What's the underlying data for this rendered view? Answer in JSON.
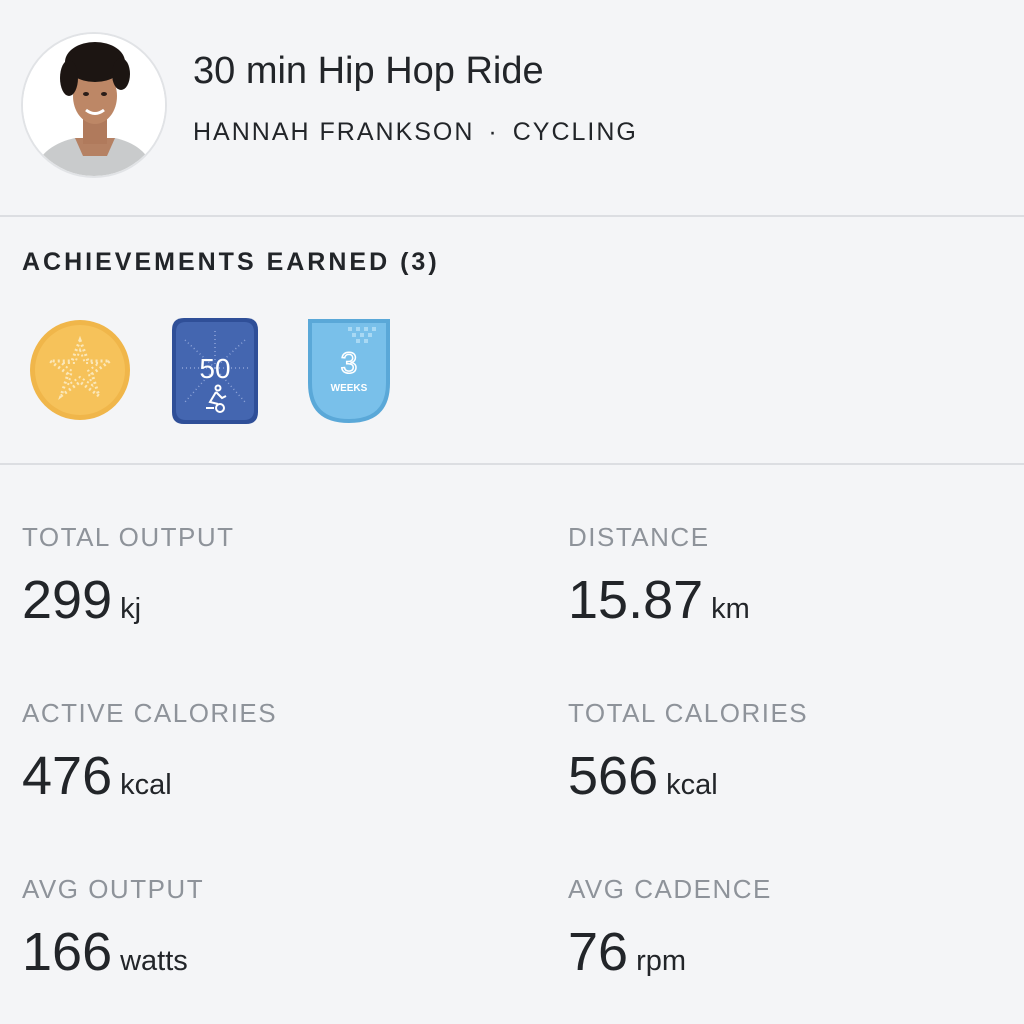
{
  "workout": {
    "title": "30 min Hip Hop Ride",
    "instructor": "HANNAH FRANKSON",
    "separator": "·",
    "discipline": "CYCLING"
  },
  "achievements": {
    "heading": "ACHIEVEMENTS EARNED (3)",
    "badges": [
      {
        "name": "star-badge-icon",
        "color": "#f2b84b"
      },
      {
        "name": "rides-50-badge-icon",
        "number": "50",
        "color": "#3f5fa6"
      },
      {
        "name": "streak-3-weeks-badge-icon",
        "number": "3",
        "label": "WEEKS",
        "color": "#6ab6e3"
      }
    ]
  },
  "stats": [
    {
      "label": "TOTAL OUTPUT",
      "value": "299",
      "unit": "kj"
    },
    {
      "label": "DISTANCE",
      "value": "15.87",
      "unit": "km"
    },
    {
      "label": "ACTIVE CALORIES",
      "value": "476",
      "unit": "kcal"
    },
    {
      "label": "TOTAL CALORIES",
      "value": "566",
      "unit": "kcal"
    },
    {
      "label": "AVG OUTPUT",
      "value": "166",
      "unit": "watts"
    },
    {
      "label": "AVG CADENCE",
      "value": "76",
      "unit": "rpm"
    }
  ],
  "colors": {
    "background": "#f4f5f7",
    "text": "#222529",
    "label": "#8e939a",
    "divider": "#dcdee2"
  }
}
